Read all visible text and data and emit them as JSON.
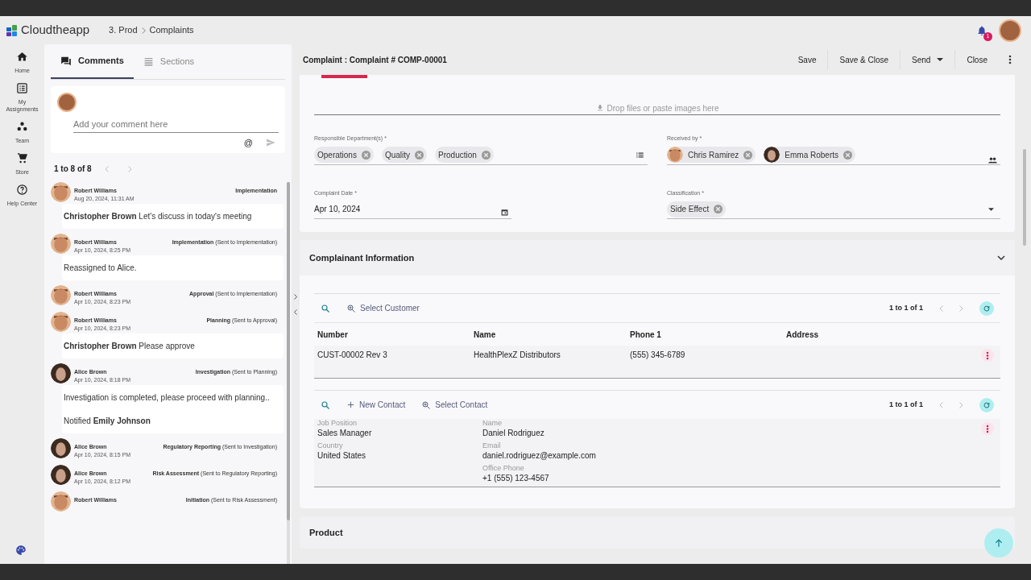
{
  "header": {
    "app_name": "Cloudtheapp",
    "breadcrumb": [
      "3. Prod",
      "Complaints"
    ],
    "notification_count": "1"
  },
  "nav": [
    {
      "label": "Home"
    },
    {
      "label": "My Assignments"
    },
    {
      "label": "Team"
    },
    {
      "label": "Store"
    },
    {
      "label": "Help Center"
    }
  ],
  "panel_tabs": [
    {
      "label": "Comments",
      "selected": true
    },
    {
      "label": "Sections",
      "selected": false
    }
  ],
  "comment_box": {
    "placeholder": "Add your comment here",
    "mention": "@"
  },
  "comments_pager": "1 to 8 of 8",
  "comments": [
    {
      "kind": "man",
      "author": "Robert Williams",
      "date": "Aug 20, 2024, 11:31 AM",
      "stage": "Implementation",
      "body": [
        "**Christopher Brown** Let's discuss in today's meeting"
      ]
    },
    {
      "kind": "man",
      "author": "Robert Williams",
      "date": "Apr 10, 2024, 8:25 PM",
      "stage": "Implementation",
      "sent_to": "(Sent to Implementation)",
      "body": [
        "Reassigned to Alice."
      ]
    },
    {
      "kind": "man",
      "author": "Robert Williams",
      "date": "Apr 10, 2024, 8:23 PM",
      "stage": "Approval",
      "sent_to": "(Sent to Implementation)"
    },
    {
      "kind": "man",
      "author": "Robert Williams",
      "date": "Apr 10, 2024, 8:23 PM",
      "stage": "Planning",
      "sent_to": "(Sent to Approval)",
      "body": [
        "**Christopher Brown** Please approve"
      ]
    },
    {
      "kind": "woman",
      "author": "Alice Brown",
      "date": "Apr 10, 2024, 8:18 PM",
      "stage": "Investigation",
      "sent_to": "(Sent to Planning)",
      "body": [
        "Investigation is completed, please proceed with planning..",
        "Notified **Emily Johnson**"
      ]
    },
    {
      "kind": "woman",
      "author": "Alice Brown",
      "date": "Apr 10, 2024, 8:15 PM",
      "stage": "Regulatory Reporting",
      "sent_to": "(Sent to Investigation)"
    },
    {
      "kind": "woman",
      "author": "Alice Brown",
      "date": "Apr 10, 2024, 8:12 PM",
      "stage": "Risk Assessment",
      "sent_to": "(Sent to Regulatory Reporting)"
    },
    {
      "kind": "man",
      "author": "Robert Williams",
      "stage": "Initiation",
      "sent_to": "(Sent to Risk Assessment)"
    }
  ],
  "toolbar": {
    "title": "Complaint : Complaint # COMP-00001",
    "buttons": [
      {
        "label": "Save",
        "kind": "plain"
      },
      {
        "label": "Save & Close",
        "kind": "plain"
      },
      {
        "label": "Send",
        "kind": "dropdown"
      },
      {
        "label": "Close",
        "kind": "plain"
      }
    ]
  },
  "drop_zone": "Drop files or paste images here",
  "fields": [
    {
      "label": "Responsible Department(s) *",
      "kind": "chips",
      "chips": [
        {
          "label": "Operations"
        },
        {
          "label": "Quality"
        },
        {
          "label": "Production"
        }
      ]
    },
    {
      "label": "Received by *",
      "kind": "people",
      "chips": [
        {
          "label": "Chris Ramirez",
          "kind": "man"
        },
        {
          "label": "Emma Roberts",
          "kind": "woman"
        }
      ]
    },
    {
      "label": "Complaint Date *",
      "kind": "date",
      "value": "Apr 10, 2024"
    },
    {
      "label": "Classification *",
      "kind": "select",
      "chips": [
        {
          "label": "Side Effect"
        }
      ]
    }
  ],
  "complainant": {
    "title": "Complainant Information",
    "expanded": true,
    "customers": {
      "select_label": "Select Customer",
      "pager": "1 to 1 of 1",
      "columns": [
        "Number",
        "Name",
        "Phone 1",
        "Address"
      ],
      "rows": [
        [
          "CUST-00002 Rev 3",
          "HealthPlexZ Distributors",
          "(555) 345-6789"
        ]
      ]
    },
    "contacts": {
      "new_label": "New Contact",
      "select_label": "Select Contact",
      "pager": "1 to 1 of 1",
      "left": [
        {
          "label": "Job Position",
          "value": "Sales Manager"
        },
        {
          "label": "Country",
          "value": "United States"
        }
      ],
      "right": [
        {
          "label": "Name",
          "value": "Daniel Rodriguez"
        },
        {
          "label": "Email",
          "value": "daniel.rodriguez@example.com"
        },
        {
          "label": "Office Phone",
          "value": "+1 (555) 123-4567"
        }
      ]
    }
  },
  "next_section": "Product"
}
